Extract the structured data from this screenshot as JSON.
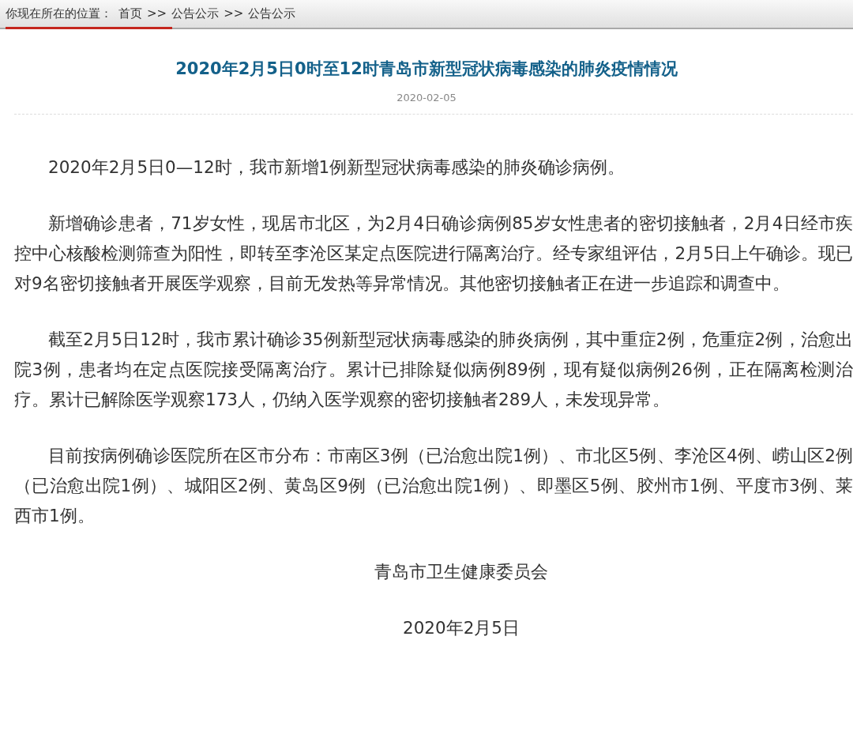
{
  "breadcrumb": {
    "label": "你现在所在的位置：",
    "items": [
      {
        "text": "首页"
      },
      {
        "text": "公告公示"
      },
      {
        "text": "公告公示"
      }
    ],
    "separator": ">>"
  },
  "article": {
    "title": "2020年2月5日0时至12时青岛市新型冠状病毒感染的肺炎疫情情况",
    "date": "2020-02-05",
    "paragraphs": [
      "2020年2月5日0—12时，我市新增1例新型冠状病毒感染的肺炎确诊病例。",
      "新增确诊患者，71岁女性，现居市北区，为2月4日确诊病例85岁女性患者的密切接触者，2月4日经市疾控中心核酸检测筛查为阳性，即转至李沧区某定点医院进行隔离治疗。经专家组评估，2月5日上午确诊。现已对9名密切接触者开展医学观察，目前无发热等异常情况。其他密切接触者正在进一步追踪和调查中。",
      "截至2月5日12时，我市累计确诊35例新型冠状病毒感染的肺炎病例，其中重症2例，危重症2例，治愈出院3例，患者均在定点医院接受隔离治疗。累计已排除疑似病例89例，现有疑似病例26例，正在隔离检测治疗。累计已解除医学观察173人，仍纳入医学观察的密切接触者289人，未发现异常。",
      "目前按病例确诊医院所在区市分布：市南区3例（已治愈出院1例）、市北区5例、李沧区4例、崂山区2例（已治愈出院1例）、城阳区2例、黄岛区9例（已治愈出院1例）、即墨区5例、胶州市1例、平度市3例、莱西市1例。"
    ],
    "signature": "青岛市卫生健康委员会",
    "signature_date": "2020年2月5日"
  }
}
